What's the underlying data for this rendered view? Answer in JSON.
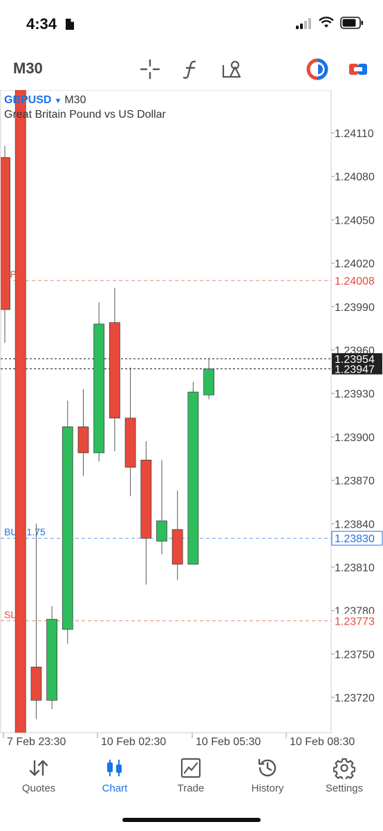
{
  "status": {
    "time": "4:34"
  },
  "toolbar": {
    "timeframe": "M30",
    "icons": [
      "crosshair-icon",
      "indicators-icon",
      "objects-icon",
      "one-click-trading-icon",
      "trade-panel-icon"
    ]
  },
  "symbol": {
    "name": "GBPUSD",
    "timeframe": "M30",
    "description": "Great Britain Pound vs US Dollar"
  },
  "colors": {
    "bull": "#2ebd5c",
    "bear": "#e8493a",
    "buy_line": "#1a73e8",
    "sl_tp": "#e8493a",
    "price_line": "#111111"
  },
  "chart_data": {
    "type": "candlestick",
    "y_axis": {
      "ticks": [
        "1.24110",
        "1.24080",
        "1.24050",
        "1.24020",
        "1.23990",
        "1.23960",
        "1.23930",
        "1.23900",
        "1.23870",
        "1.23840",
        "1.23810",
        "1.23780",
        "1.23750",
        "1.23720"
      ],
      "range": [
        1.2369,
        1.24125
      ]
    },
    "x_axis": {
      "labels": [
        "7 Feb 23:30",
        "10 Feb 02:30",
        "10 Feb 05:30",
        "10 Feb 08:30"
      ]
    },
    "levels": [
      {
        "label": "TP",
        "price": 1.24008,
        "price_label": "1.24008",
        "kind": "tp"
      },
      {
        "label": "BUY 1.75",
        "price": 1.2383,
        "price_label": "1.23830",
        "kind": "buy"
      },
      {
        "label": "SL",
        "price": 1.23773,
        "price_label": "1.23773",
        "kind": "sl"
      }
    ],
    "price_lines": [
      {
        "price": 1.23954,
        "label": "1.23954"
      },
      {
        "price": 1.23947,
        "label": "1.23947"
      }
    ],
    "candles": [
      {
        "o": 1.24093,
        "h": 1.24101,
        "l": 1.23965,
        "c": 1.23988
      },
      {
        "o": 1.24165,
        "h": 1.24189,
        "l": 1.23685,
        "c": 1.2369
      },
      {
        "o": 1.23741,
        "h": 1.2384,
        "l": 1.23705,
        "c": 1.23718
      },
      {
        "o": 1.23718,
        "h": 1.23783,
        "l": 1.23712,
        "c": 1.23774
      },
      {
        "o": 1.23767,
        "h": 1.23925,
        "l": 1.23757,
        "c": 1.23907
      },
      {
        "o": 1.23907,
        "h": 1.23933,
        "l": 1.23873,
        "c": 1.23889
      },
      {
        "o": 1.23889,
        "h": 1.23993,
        "l": 1.23883,
        "c": 1.23978
      },
      {
        "o": 1.23979,
        "h": 1.24003,
        "l": 1.2389,
        "c": 1.23913
      },
      {
        "o": 1.23913,
        "h": 1.23948,
        "l": 1.23859,
        "c": 1.23879
      },
      {
        "o": 1.23884,
        "h": 1.23897,
        "l": 1.23798,
        "c": 1.2383
      },
      {
        "o": 1.23828,
        "h": 1.23884,
        "l": 1.23819,
        "c": 1.23842
      },
      {
        "o": 1.23836,
        "h": 1.23863,
        "l": 1.23801,
        "c": 1.23812
      },
      {
        "o": 1.23812,
        "h": 1.23938,
        "l": 1.23812,
        "c": 1.23931
      },
      {
        "o": 1.23929,
        "h": 1.23954,
        "l": 1.23926,
        "c": 1.23947
      }
    ]
  },
  "nav": [
    {
      "label": "Quotes",
      "icon": "quotes-icon",
      "active": false
    },
    {
      "label": "Chart",
      "icon": "chart-icon",
      "active": true
    },
    {
      "label": "Trade",
      "icon": "trade-icon",
      "active": false
    },
    {
      "label": "History",
      "icon": "history-icon",
      "active": false
    },
    {
      "label": "Settings",
      "icon": "settings-icon",
      "active": false
    }
  ]
}
